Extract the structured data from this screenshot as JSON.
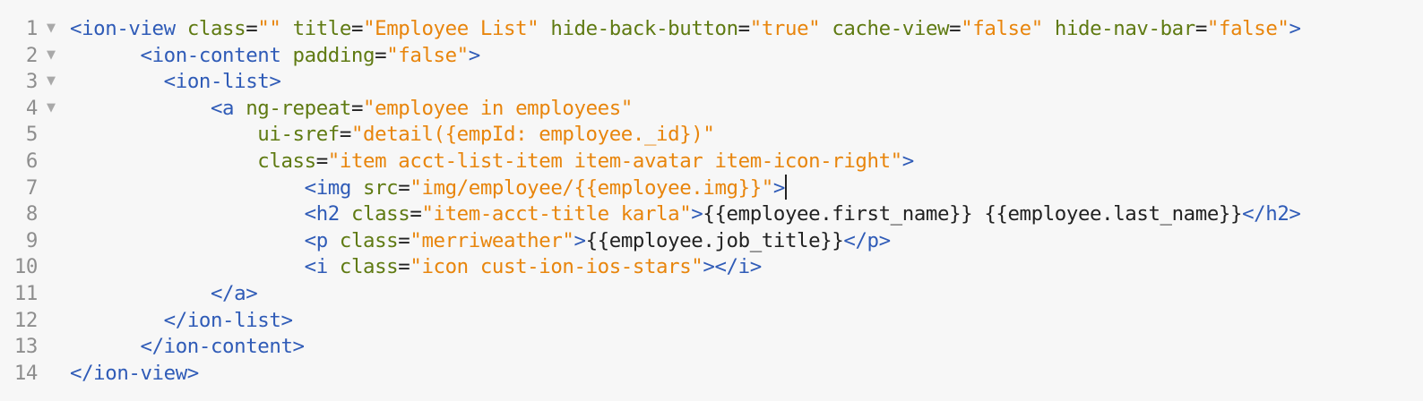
{
  "colors": {
    "background": "#f7f7f7",
    "line_number": "#8e8e8e",
    "fold_marker": "#a9a9a9",
    "tag": "#2f5bb7",
    "attribute": "#5f7a12",
    "string": "#e8850c",
    "text": "#222222"
  },
  "fold_marker_icon": "triangle-down",
  "lines": [
    {
      "num": "1",
      "fold": "▼",
      "tokens": [
        {
          "t": "<ion-view",
          "k": "tag"
        },
        {
          "t": " class",
          "k": "attribute"
        },
        {
          "t": "=",
          "k": "text"
        },
        {
          "t": "\"\"",
          "k": "string"
        },
        {
          "t": " title",
          "k": "attribute"
        },
        {
          "t": "=",
          "k": "text"
        },
        {
          "t": "\"Employee List\"",
          "k": "string"
        },
        {
          "t": " hide-back-button",
          "k": "attribute"
        },
        {
          "t": "=",
          "k": "text"
        },
        {
          "t": "\"true\"",
          "k": "string"
        },
        {
          "t": " cache-view",
          "k": "attribute"
        },
        {
          "t": "=",
          "k": "text"
        },
        {
          "t": "\"false\"",
          "k": "string"
        },
        {
          "t": " hide-nav-bar",
          "k": "attribute"
        },
        {
          "t": "=",
          "k": "text"
        },
        {
          "t": "\"false\"",
          "k": "string"
        },
        {
          "t": ">",
          "k": "tag"
        }
      ]
    },
    {
      "num": "2",
      "fold": "▼",
      "tokens": [
        {
          "t": "      ",
          "k": "text"
        },
        {
          "t": "<ion-content",
          "k": "tag"
        },
        {
          "t": " padding",
          "k": "attribute"
        },
        {
          "t": "=",
          "k": "text"
        },
        {
          "t": "\"false\"",
          "k": "string"
        },
        {
          "t": ">",
          "k": "tag"
        }
      ]
    },
    {
      "num": "3",
      "fold": "▼",
      "tokens": [
        {
          "t": "        ",
          "k": "text"
        },
        {
          "t": "<ion-list",
          "k": "tag"
        },
        {
          "t": ">",
          "k": "tag"
        }
      ]
    },
    {
      "num": "4",
      "fold": "▼",
      "tokens": [
        {
          "t": "            ",
          "k": "text"
        },
        {
          "t": "<a",
          "k": "tag"
        },
        {
          "t": " ng-repeat",
          "k": "attribute"
        },
        {
          "t": "=",
          "k": "text"
        },
        {
          "t": "\"employee in employees\"",
          "k": "string"
        }
      ]
    },
    {
      "num": "5",
      "fold": "",
      "tokens": [
        {
          "t": "                ",
          "k": "text"
        },
        {
          "t": "ui-sref",
          "k": "attribute"
        },
        {
          "t": "=",
          "k": "text"
        },
        {
          "t": "\"detail({empId: employee._id})\"",
          "k": "string"
        }
      ]
    },
    {
      "num": "6",
      "fold": "",
      "tokens": [
        {
          "t": "                ",
          "k": "text"
        },
        {
          "t": "class",
          "k": "attribute"
        },
        {
          "t": "=",
          "k": "text"
        },
        {
          "t": "\"item acct-list-item item-avatar item-icon-right\"",
          "k": "string"
        },
        {
          "t": ">",
          "k": "tag"
        }
      ]
    },
    {
      "num": "7",
      "fold": "",
      "cursor_after": true,
      "tokens": [
        {
          "t": "                    ",
          "k": "text"
        },
        {
          "t": "<img",
          "k": "tag"
        },
        {
          "t": " src",
          "k": "attribute"
        },
        {
          "t": "=",
          "k": "text"
        },
        {
          "t": "\"img/employee/{{employee.img}}\"",
          "k": "string"
        },
        {
          "t": ">",
          "k": "tag"
        }
      ]
    },
    {
      "num": "8",
      "fold": "",
      "tokens": [
        {
          "t": "                    ",
          "k": "text"
        },
        {
          "t": "<h2",
          "k": "tag"
        },
        {
          "t": " class",
          "k": "attribute"
        },
        {
          "t": "=",
          "k": "text"
        },
        {
          "t": "\"item-acct-title karla\"",
          "k": "string"
        },
        {
          "t": ">",
          "k": "tag"
        },
        {
          "t": "{{employee.first_name}} {{employee.last_name}}",
          "k": "text"
        },
        {
          "t": "</h2>",
          "k": "tag"
        }
      ]
    },
    {
      "num": "9",
      "fold": "",
      "tokens": [
        {
          "t": "                    ",
          "k": "text"
        },
        {
          "t": "<p",
          "k": "tag"
        },
        {
          "t": " class",
          "k": "attribute"
        },
        {
          "t": "=",
          "k": "text"
        },
        {
          "t": "\"merriweather\"",
          "k": "string"
        },
        {
          "t": ">",
          "k": "tag"
        },
        {
          "t": "{{employee.job_title}}",
          "k": "text"
        },
        {
          "t": "</p>",
          "k": "tag"
        }
      ]
    },
    {
      "num": "10",
      "fold": "",
      "tokens": [
        {
          "t": "                    ",
          "k": "text"
        },
        {
          "t": "<i",
          "k": "tag"
        },
        {
          "t": " class",
          "k": "attribute"
        },
        {
          "t": "=",
          "k": "text"
        },
        {
          "t": "\"icon cust-ion-ios-stars\"",
          "k": "string"
        },
        {
          "t": "></i>",
          "k": "tag"
        }
      ]
    },
    {
      "num": "11",
      "fold": "",
      "tokens": [
        {
          "t": "            ",
          "k": "text"
        },
        {
          "t": "</a>",
          "k": "tag"
        }
      ]
    },
    {
      "num": "12",
      "fold": "",
      "tokens": [
        {
          "t": "        ",
          "k": "text"
        },
        {
          "t": "</ion-list>",
          "k": "tag"
        }
      ]
    },
    {
      "num": "13",
      "fold": "",
      "tokens": [
        {
          "t": "      ",
          "k": "text"
        },
        {
          "t": "</ion-content>",
          "k": "tag"
        }
      ]
    },
    {
      "num": "14",
      "fold": "",
      "tokens": [
        {
          "t": "</ion-view>",
          "k": "tag"
        }
      ]
    }
  ]
}
